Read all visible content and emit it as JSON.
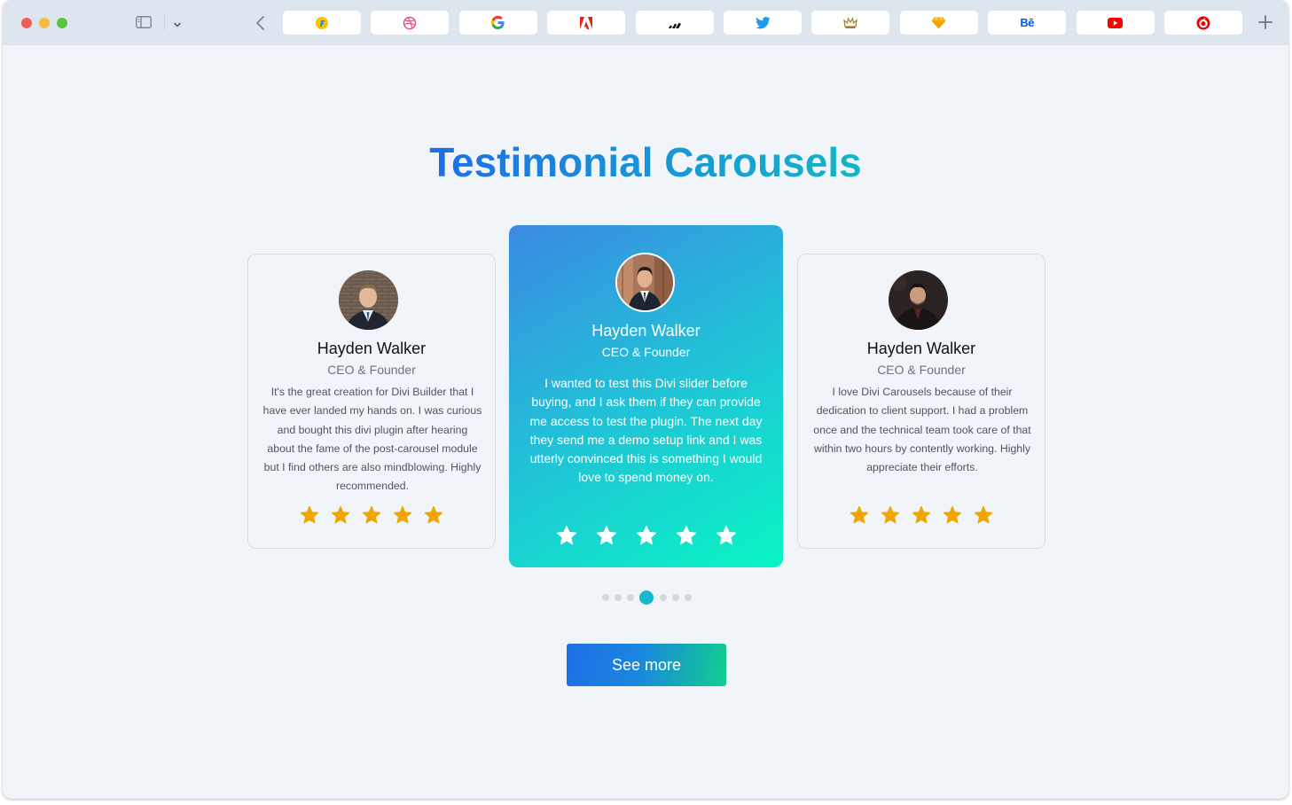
{
  "browser": {
    "tabs": [
      {
        "icon": "flipkart-icon",
        "color": "#f7c400"
      },
      {
        "icon": "dribbble-icon",
        "color": "#ea4c89"
      },
      {
        "icon": "google-icon",
        "color": "#4285f4"
      },
      {
        "icon": "adobe-icon",
        "color": "#e1251b"
      },
      {
        "icon": "adidas-icon",
        "color": "#111111"
      },
      {
        "icon": "twitter-icon",
        "color": "#1d9bf0"
      },
      {
        "icon": "rolex-icon",
        "color": "#a37e2c"
      },
      {
        "icon": "sketch-icon",
        "color": "#fdb300"
      },
      {
        "icon": "behance-icon",
        "color": "#0057ff",
        "text": "Bē"
      },
      {
        "icon": "youtube-icon",
        "color": "#ff0000"
      },
      {
        "icon": "vodafone-icon",
        "color": "#e60000"
      }
    ]
  },
  "page": {
    "title": "Testimonial Carousels",
    "see_more_label": "See more"
  },
  "testimonials": [
    {
      "name": "Hayden Walker",
      "role": "CEO & Founder",
      "quote_lines": [
        "It's the great creation for Divi Builder that I",
        "have ever landed my hands on. I was curious",
        "and bought this divi plugin after hearing",
        "about the fame of the post-carousel module",
        "but I find others are also mindblowing. Highly",
        "recommended."
      ],
      "rating": 5
    },
    {
      "name": "Hayden Walker",
      "role": "CEO & Founder",
      "quote_lines": [
        "I wanted to test this Divi slider before",
        "buying, and I ask them if they can provide",
        "me access to test the plugin. The next day",
        "they send me a demo setup link and I was",
        "utterly convinced this is something I would",
        "love to spend money on."
      ],
      "rating": 5
    },
    {
      "name": "Hayden Walker",
      "role": "CEO & Founder",
      "quote_lines": [
        "I love Divi Carousels because of their",
        "dedication to client support. I had a problem",
        "once and the technical team took care of that",
        "within two hours by contently working. Highly",
        "appreciate their efforts."
      ],
      "rating": 5
    }
  ],
  "pagination": {
    "total": 7,
    "active_index": 3
  },
  "colors": {
    "star_gold": "#f0a500",
    "star_white": "#ffffff",
    "accent_blue": "#1d6fe6",
    "accent_teal": "#14b7c6"
  }
}
